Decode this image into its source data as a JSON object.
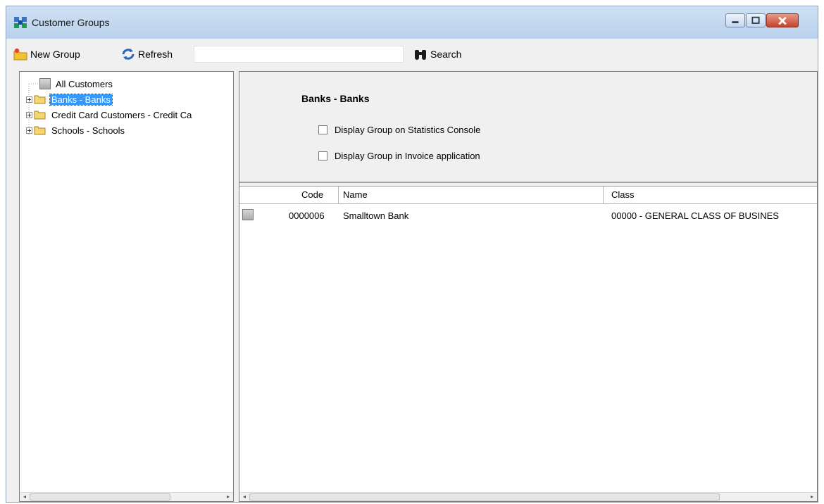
{
  "window": {
    "title": "Customer Groups",
    "controls": {
      "minimize": "minimize-icon",
      "maximize": "maximize-icon",
      "close": "close-icon"
    }
  },
  "toolbar": {
    "new_group_label": "New Group",
    "refresh_label": "Refresh",
    "search_value": "",
    "search_label": "Search"
  },
  "tree": {
    "items": [
      {
        "label": "All Customers",
        "icon": "customer-icon"
      },
      {
        "label": "Banks - Banks",
        "icon": "folder-open-icon",
        "selected": true
      },
      {
        "label": "Credit Card Customers - Credit Ca",
        "icon": "folder-icon"
      },
      {
        "label": "Schools - Schools",
        "icon": "folder-icon"
      }
    ]
  },
  "group": {
    "title": "Banks - Banks",
    "checkboxes": [
      {
        "label": "Display Group on Statistics Console",
        "checked": false
      },
      {
        "label": "Display Group in Invoice application",
        "checked": false
      }
    ]
  },
  "grid": {
    "columns": [
      "Code",
      "Name",
      "Class"
    ],
    "rows": [
      {
        "code": "0000006",
        "name": "Smalltown Bank",
        "class": "00000 - GENERAL CLASS OF BUSINES"
      }
    ]
  },
  "colors": {
    "titlebar": "#c4d8ef",
    "selection": "#3399ff",
    "close_button": "#c3452b"
  }
}
